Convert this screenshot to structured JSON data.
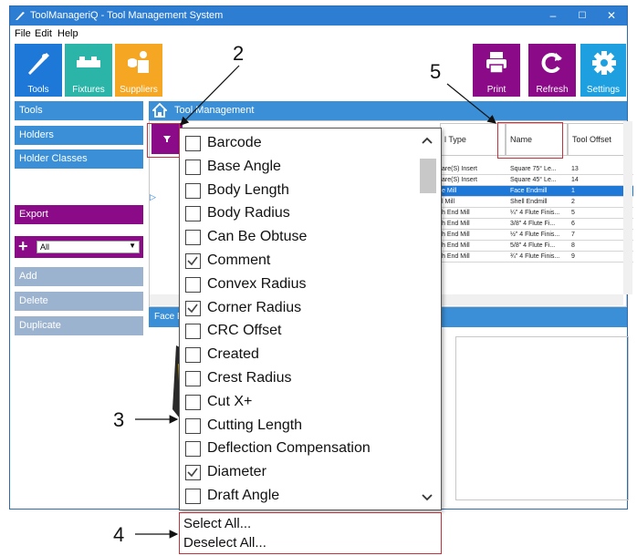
{
  "window": {
    "title": "ToolManageriQ - Tool Management System",
    "controls": [
      "–",
      "☐",
      "✕"
    ]
  },
  "menu": [
    "File",
    "Edit",
    "Help"
  ],
  "toolbar": {
    "left": [
      {
        "label": "Tools",
        "color": "#1e78d8",
        "icon": "tool-icon"
      },
      {
        "label": "Fixtures",
        "color": "#2bb5a8",
        "icon": "fixture-icon"
      },
      {
        "label": "Suppliers",
        "color": "#f5a623",
        "icon": "supplier-icon"
      }
    ],
    "right": [
      {
        "label": "Print",
        "color": "#8a0a88",
        "icon": "printer-icon"
      },
      {
        "label": "Refresh",
        "color": "#8a0a88",
        "icon": "refresh-icon"
      },
      {
        "label": "Settings",
        "color": "#1ea0e0",
        "icon": "gear-icon"
      }
    ]
  },
  "sidebar": {
    "nav": [
      "Tools",
      "Holders",
      "Holder Classes"
    ],
    "export": "Export",
    "combo_value": "All",
    "actions": [
      "Add",
      "Delete",
      "Duplicate"
    ]
  },
  "header_bar": {
    "title": "Tool Management"
  },
  "grid": {
    "columns": [
      "l Type",
      "Name",
      "Tool Offset"
    ],
    "rows": [
      {
        "type": "are(S) Insert",
        "name": "Square 75° Le...",
        "offset": "13",
        "selected": false
      },
      {
        "type": "are(S) Insert",
        "name": "Square 45° Le...",
        "offset": "14",
        "selected": false
      },
      {
        "type": "e Mill",
        "name": "Face Endmill",
        "offset": "1",
        "selected": true
      },
      {
        "type": "l Mill",
        "name": "Shell Endmill",
        "offset": "2",
        "selected": false
      },
      {
        "type": "h End Mill",
        "name": "¼\" 4 Flute Finis...",
        "offset": "5",
        "selected": false
      },
      {
        "type": "h End Mill",
        "name": "3/8\" 4 Flute Fi...",
        "offset": "6",
        "selected": false
      },
      {
        "type": "h End Mill",
        "name": "½\" 4 Flute Finis...",
        "offset": "7",
        "selected": false
      },
      {
        "type": "h End Mill",
        "name": "5/8\" 4 Flute Fi...",
        "offset": "8",
        "selected": false
      },
      {
        "type": "h End Mill",
        "name": "¾\" 4 Flute Finis...",
        "offset": "9",
        "selected": false
      }
    ]
  },
  "detail_bar": {
    "title": "Face E"
  },
  "column_filter": {
    "options": [
      {
        "label": "Barcode",
        "checked": false
      },
      {
        "label": "Base Angle",
        "checked": false
      },
      {
        "label": "Body Length",
        "checked": false
      },
      {
        "label": "Body Radius",
        "checked": false
      },
      {
        "label": "Can Be Obtuse",
        "checked": false
      },
      {
        "label": "Comment",
        "checked": true
      },
      {
        "label": "Convex Radius",
        "checked": false
      },
      {
        "label": "Corner Radius",
        "checked": true
      },
      {
        "label": "CRC Offset",
        "checked": false
      },
      {
        "label": "Created",
        "checked": false
      },
      {
        "label": "Crest Radius",
        "checked": false
      },
      {
        "label": "Cut X+",
        "checked": false
      },
      {
        "label": "Cutting Length",
        "checked": false
      },
      {
        "label": "Deflection Compensation",
        "checked": false
      },
      {
        "label": "Diameter",
        "checked": true
      },
      {
        "label": "Draft Angle",
        "checked": false
      }
    ],
    "select_all": "Select All...",
    "deselect_all": "Deselect All..."
  },
  "callouts": [
    "2",
    "3",
    "4",
    "5"
  ]
}
